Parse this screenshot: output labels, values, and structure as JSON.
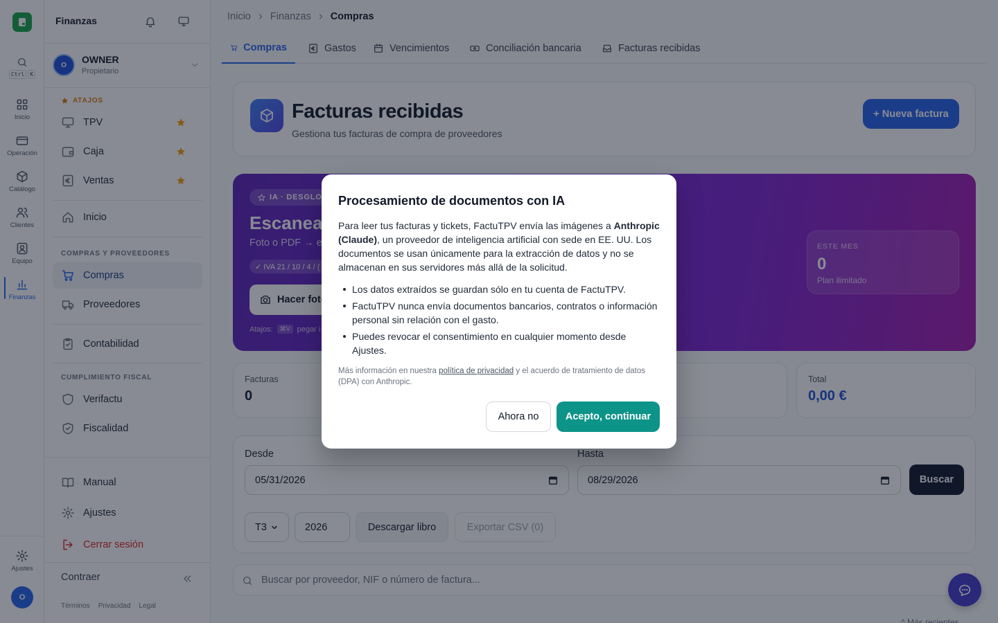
{
  "rail": {
    "ctrl_key": "Ctrl",
    "k_key": "K",
    "items": [
      {
        "label": "Inicio"
      },
      {
        "label": "Operación"
      },
      {
        "label": "Catálogo"
      },
      {
        "label": "Clientes"
      },
      {
        "label": "Equipo"
      },
      {
        "label": "Finanzas"
      }
    ],
    "settings_label": "Ajustes",
    "avatar_initial": "O"
  },
  "sidebar": {
    "title": "Finanzas",
    "user": {
      "initial": "O",
      "name": "OWNER",
      "role": "Propietario"
    },
    "shortcuts_title": "ATAJOS",
    "shortcuts": [
      {
        "label": "TPV"
      },
      {
        "label": "Caja"
      },
      {
        "label": "Ventas"
      }
    ],
    "home_label": "Inicio",
    "section_purchases": "COMPRAS Y PROVEEDORES",
    "purchases_label": "Compras",
    "suppliers_label": "Proveedores",
    "accounting_label": "Contabilidad",
    "section_fiscal": "CUMPLIMIENTO FISCAL",
    "verifactu_label": "Verifactu",
    "fiscal_label": "Fiscalidad",
    "manual_label": "Manual",
    "settings_label": "Ajustes",
    "logout_label": "Cerrar sesión",
    "collapse_label": "Contraer",
    "legal": [
      "Términos",
      "Privacidad",
      "Legal"
    ]
  },
  "breadcrumb": [
    "Inicio",
    "Finanzas",
    "Compras"
  ],
  "tabs": [
    {
      "label": "Compras"
    },
    {
      "label": "Gastos"
    },
    {
      "label": "Vencimientos"
    },
    {
      "label": "Conciliación bancaria"
    },
    {
      "label": "Facturas recibidas"
    }
  ],
  "header": {
    "title": "Facturas recibidas",
    "subtitle": "Gestiona tus facturas de compra de proveedores",
    "new_button": "+ Nueva factura"
  },
  "promo": {
    "tag": "IA · DESGLOS",
    "title": "Escanea u",
    "subtitle": "Foto o PDF → e",
    "pill": "✓ IVA 21 / 10 / 4 / (",
    "button": "Hacer foto",
    "hint_prefix": "Atajos:",
    "hint_key": "⌘V",
    "hint_suffix": "pegar i",
    "stat_label": "ESTE MES",
    "stat_value": "0",
    "stat_caption": "Plan ilimitado"
  },
  "stats": {
    "invoices_label": "Facturas",
    "invoices_value": "0",
    "total_label": "Total",
    "total_value": "0,00 €"
  },
  "filters": {
    "from_label": "Desde",
    "from_value": "05/31/2026",
    "to_label": "Hasta",
    "to_value": "08/29/2026",
    "search_button": "Buscar",
    "quarter_value": "T3",
    "year_value": "2026",
    "download_button": "Descargar libro",
    "export_button": "Exportar CSV (0)"
  },
  "search": {
    "placeholder": "Buscar por proveedor, NIF o número de factura..."
  },
  "more_recent": "^ Más recientes",
  "modal": {
    "title": "Procesamiento de documentos con IA",
    "body_1": "Para leer tus facturas y tickets, FactuTPV envía las imágenes a ",
    "body_bold": "Anthropic (Claude)",
    "body_2": ", un proveedor de inteligencia artificial con sede en EE. UU. Los documentos se usan únicamente para la extracción de datos y no se almacenan en sus servidores más allá de la solicitud.",
    "bullets": [
      "Los datos extraídos se guardan sólo en tu cuenta de FactuTPV.",
      "FactuTPV nunca envía documentos bancarios, contratos o información personal sin relación con el gasto.",
      "Puedes revocar el consentimiento en cualquier momento desde Ajustes."
    ],
    "foot_1": "Más información en nuestra ",
    "foot_link": "política de privacidad",
    "foot_2": " y el acuerdo de tratamiento de datos (DPA) con Anthropic.",
    "decline_button": "Ahora no",
    "accept_button": "Acepto, continuar"
  },
  "colors": {
    "brand_green": "#16a34a",
    "accent_blue": "#2563eb",
    "accept_teal": "#0d9488",
    "promo_purple": "#6d28d9",
    "danger_red": "#dc2626"
  }
}
